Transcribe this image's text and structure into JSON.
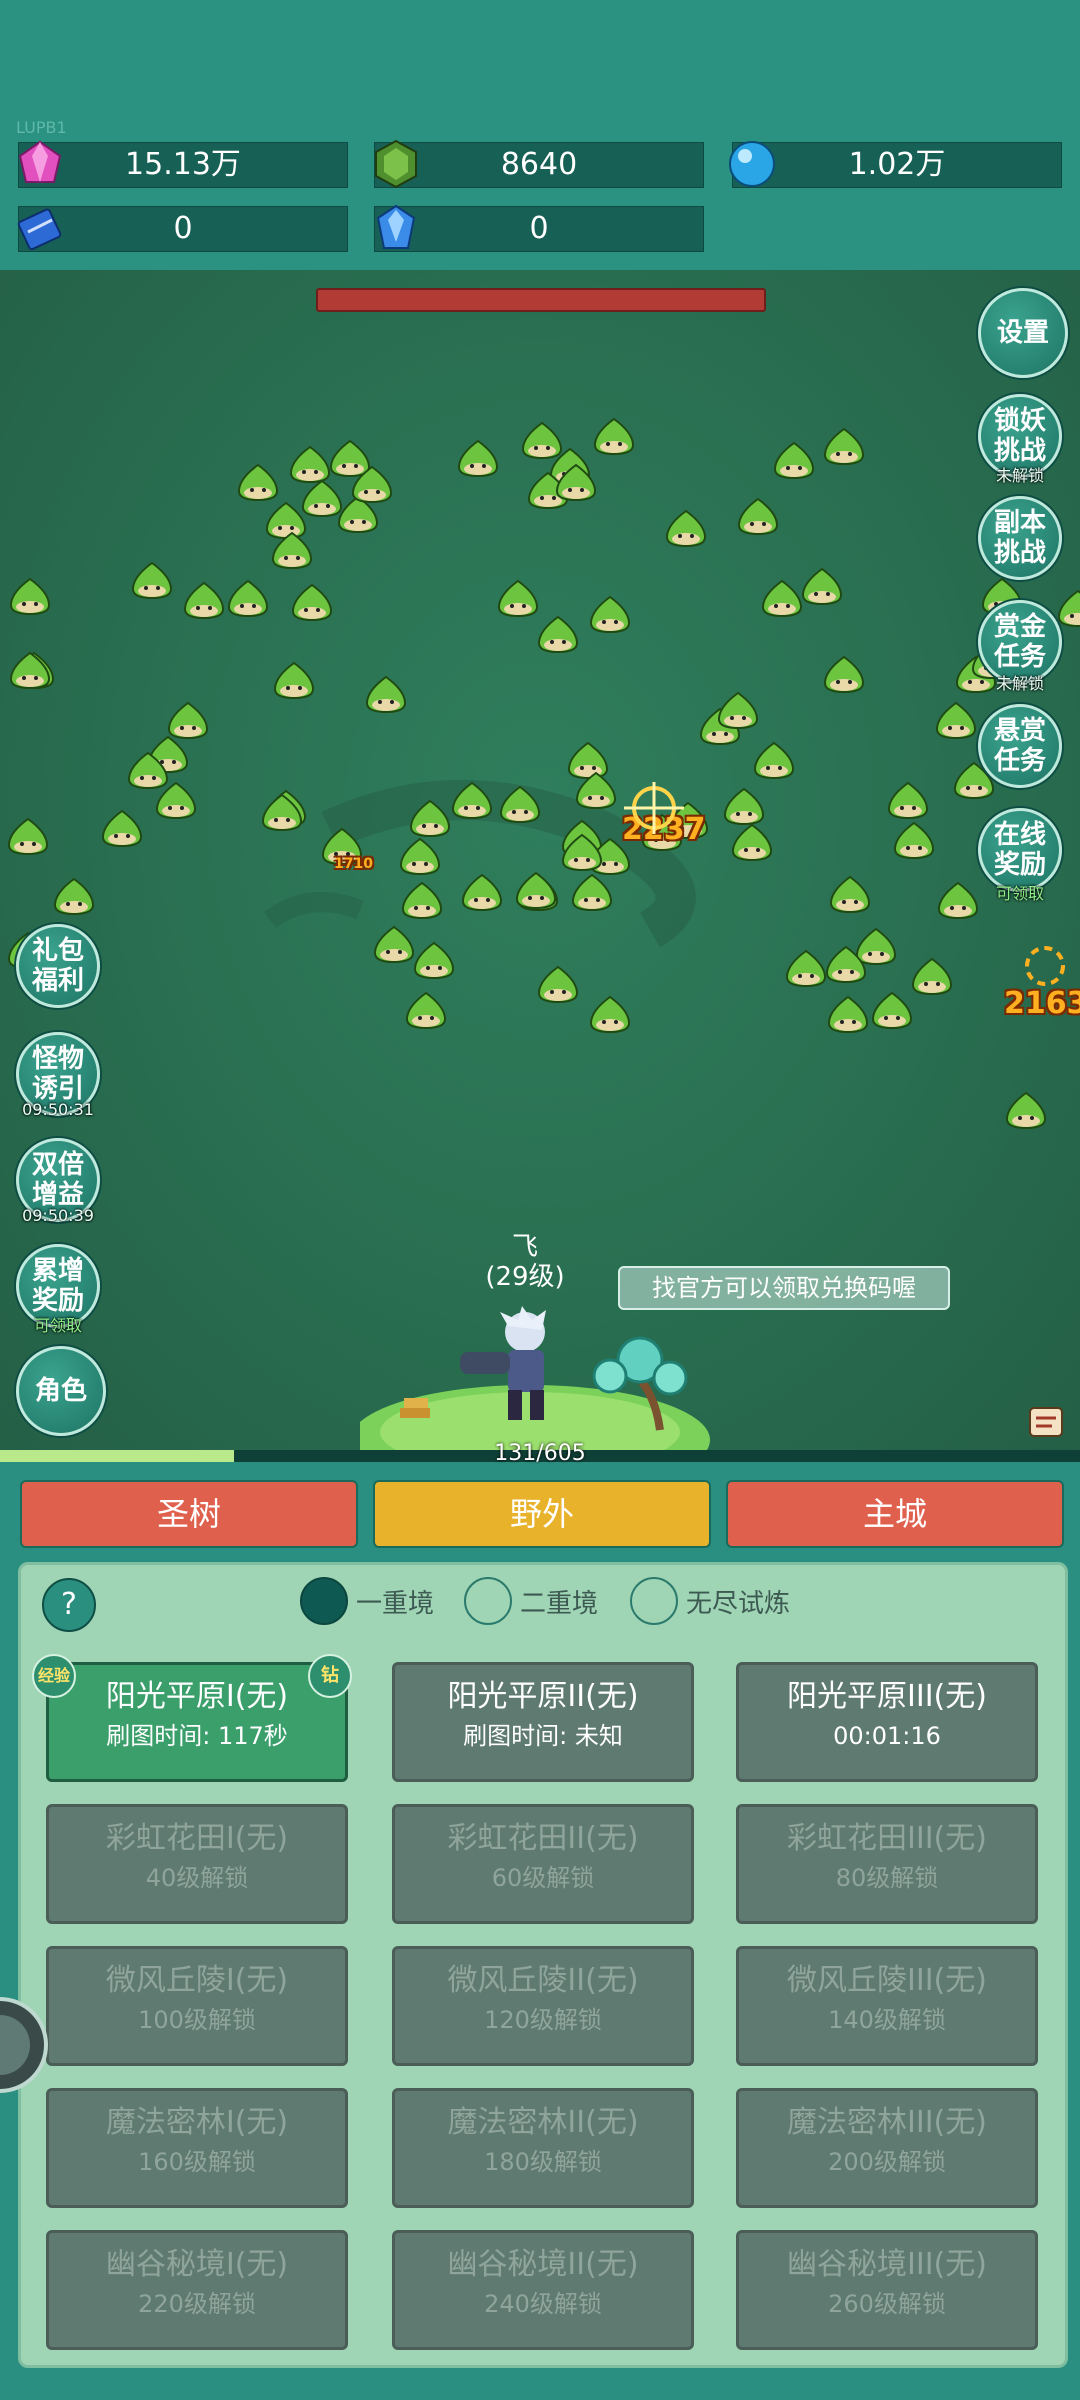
{
  "header": {
    "version": "LUPB1",
    "resources": [
      {
        "icon": "pink-gem-icon",
        "value": "15.13万"
      },
      {
        "icon": "green-crystal-icon",
        "value": "8640"
      },
      {
        "icon": "blue-orb-icon",
        "value": "1.02万"
      },
      {
        "icon": "blue-book-icon",
        "value": "0"
      },
      {
        "icon": "blue-diamond-icon",
        "value": "0"
      }
    ]
  },
  "right_menu": [
    {
      "label": "设置",
      "sub": ""
    },
    {
      "label": "锁妖挑战",
      "sub": "未解锁"
    },
    {
      "label": "副本挑战",
      "sub": ""
    },
    {
      "label": "赏金任务",
      "sub": "未解锁"
    },
    {
      "label": "悬赏任务",
      "sub": ""
    },
    {
      "label": "在线奖励",
      "sub": "可领取"
    }
  ],
  "left_menu": [
    {
      "label": "礼包福利",
      "sub": ""
    },
    {
      "label": "怪物诱引",
      "sub": "09:50:31"
    },
    {
      "label": "双倍增益",
      "sub": "09:50:39"
    },
    {
      "label": "累增奖励",
      "sub": "可领取"
    },
    {
      "label": "角色",
      "sub": ""
    }
  ],
  "battle": {
    "damage": [
      "2237",
      "2163",
      "1710"
    ],
    "player_name": "飞",
    "player_level": "(29级)",
    "tip": "找官方可以领取兑换码喔",
    "exp_text": "131/605",
    "exp_ratio": 0.2166
  },
  "tabs": [
    {
      "label": "圣树",
      "color": "#e0604e"
    },
    {
      "label": "野外",
      "color": "#e8b22a"
    },
    {
      "label": "主城",
      "color": "#e0604e"
    }
  ],
  "panel": {
    "help": "?",
    "modes": [
      {
        "label": "一重境",
        "selected": true
      },
      {
        "label": "二重境",
        "selected": false
      },
      {
        "label": "无尽试炼",
        "selected": false
      }
    ],
    "badges": {
      "left": "经验",
      "right": "钻"
    },
    "stages": [
      {
        "name": "阳光平原I(无)",
        "sub": "刷图时间: 117秒",
        "state": "active"
      },
      {
        "name": "阳光平原II(无)",
        "sub": "刷图时间: 未知",
        "state": "open"
      },
      {
        "name": "阳光平原III(无)",
        "sub": "00:01:16",
        "state": "open"
      },
      {
        "name": "彩虹花田I(无)",
        "sub": "40级解锁",
        "state": "locked"
      },
      {
        "name": "彩虹花田II(无)",
        "sub": "60级解锁",
        "state": "locked"
      },
      {
        "name": "彩虹花田III(无)",
        "sub": "80级解锁",
        "state": "locked"
      },
      {
        "name": "微风丘陵I(无)",
        "sub": "100级解锁",
        "state": "locked"
      },
      {
        "name": "微风丘陵II(无)",
        "sub": "120级解锁",
        "state": "locked"
      },
      {
        "name": "微风丘陵III(无)",
        "sub": "140级解锁",
        "state": "locked"
      },
      {
        "name": "魔法密林I(无)",
        "sub": "160级解锁",
        "state": "locked"
      },
      {
        "name": "魔法密林II(无)",
        "sub": "180级解锁",
        "state": "locked"
      },
      {
        "name": "魔法密林III(无)",
        "sub": "200级解锁",
        "state": "locked"
      },
      {
        "name": "幽谷秘境I(无)",
        "sub": "220级解锁",
        "state": "locked"
      },
      {
        "name": "幽谷秘境II(无)",
        "sub": "240级解锁",
        "state": "locked"
      },
      {
        "name": "幽谷秘境III(无)",
        "sub": "260级解锁",
        "state": "locked"
      }
    ]
  }
}
